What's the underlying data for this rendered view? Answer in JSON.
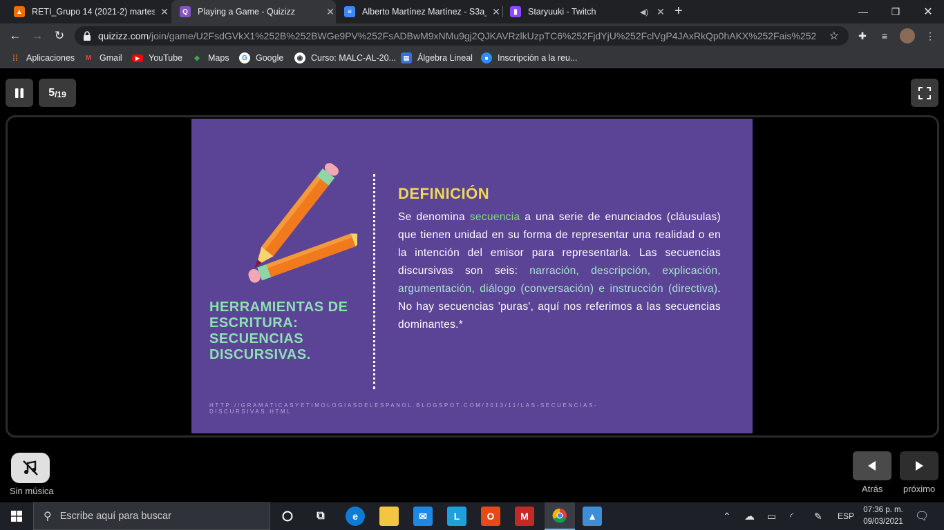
{
  "browser": {
    "tabs": [
      {
        "title": "RETI_Grupo 14 (2021-2) martes y",
        "favicon_color": "#e8710a",
        "active": false
      },
      {
        "title": "Playing a Game - Quizizz",
        "favicon_color": "#8854c0",
        "active": true
      },
      {
        "title": "Alberto Martínez Martínez - S3a_",
        "favicon_color": "#4285f4",
        "active": false
      },
      {
        "title": "Staryuuki - Twitch",
        "favicon_color": "#9146ff",
        "active": false
      }
    ],
    "url_host": "quizizz.com",
    "url_path": "/join/game/U2FsdGVkX1%252B%252BWGe9PV%252FsADBwM9xNMu9gj2QJKAVRzlkUzpTC6%252FjdYjU%252FclVgP4JAxRkQp0hAKX%252Fais%252FK%25...",
    "bookmarks": [
      {
        "label": "Aplicaciones",
        "icon": "apps-grid-icon"
      },
      {
        "label": "Gmail",
        "icon": "gmail-icon"
      },
      {
        "label": "YouTube",
        "icon": "youtube-icon"
      },
      {
        "label": "Maps",
        "icon": "maps-icon"
      },
      {
        "label": "Google",
        "icon": "google-icon"
      },
      {
        "label": "Curso: MALC-AL-20...",
        "icon": "globe-icon"
      },
      {
        "label": "Álgebra Lineal",
        "icon": "calendar-icon"
      },
      {
        "label": "Inscripción a la reu...",
        "icon": "zoom-icon"
      }
    ]
  },
  "game": {
    "question_current": "5",
    "question_total": "/19",
    "slide": {
      "left_title": "HERRAMIENTAS DE ESCRITURA: SECUENCIAS DISCURSIVAS.",
      "def_title": "DEFINICIÓN",
      "def_p1": "Se denomina ",
      "def_highlight": "secuencia",
      "def_p2": " a una serie de enunciados (cláusulas) que tienen unidad en su forma de representar una realidad o en la intención del emisor para representarla. Las secuencias discursivas son seis: ",
      "def_types": "narración, descripción, explicación, argumentación, diálogo (conversación) e instrucción (directiva)",
      "def_p3": ". No hay secuencias 'puras', aquí nos referimos a las secuencias dominantes.*",
      "source": "HTTP://GRAMATICASYETIMOLOGIASDELESPANOL.BLOGSPOT.COM/2013/11/LAS-SECUENCIAS-DISCURSIVAS.HTML"
    },
    "music_label": "Sin música",
    "back_label": "Atrás",
    "next_label": "próximo"
  },
  "taskbar": {
    "search_placeholder": "Escribe aquí para buscar",
    "language": "ESP",
    "time": "07:36 p. m.",
    "date": "09/03/2021"
  },
  "colors": {
    "slide_bg": "#5b4396",
    "title_green": "#8fe0b5",
    "def_yellow": "#f2d94e",
    "highlight_green": "#7fe07f"
  }
}
